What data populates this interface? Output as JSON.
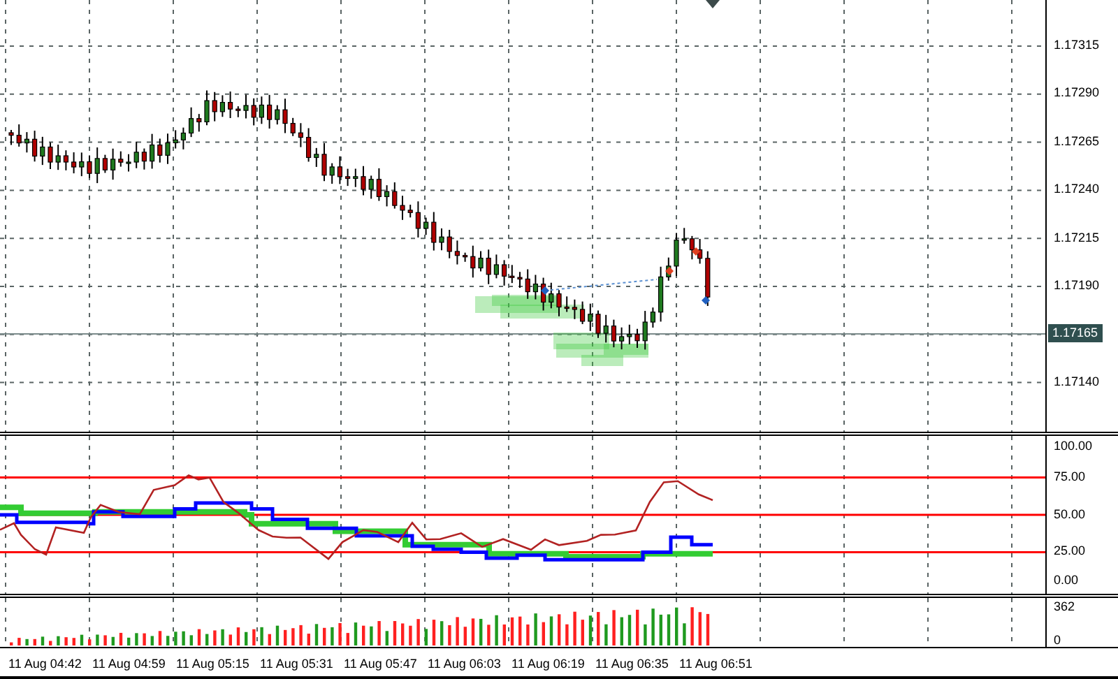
{
  "price_axis": {
    "labels": [
      "1.17315",
      "1.17290",
      "1.17265",
      "1.17240",
      "1.17215",
      "1.17190",
      "1.17140"
    ],
    "current_price": "1.17165"
  },
  "oscillator_axis": {
    "labels": [
      "100.00",
      "75.00",
      "50.00",
      "25.00",
      "0.00"
    ]
  },
  "volume_axis": {
    "labels": [
      "362",
      "0"
    ]
  },
  "time_axis": {
    "labels": [
      "11 Aug 04:42",
      "11 Aug 04:59",
      "11 Aug 05:15",
      "11 Aug 05:31",
      "11 Aug 05:47",
      "11 Aug 06:03",
      "11 Aug 06:19",
      "11 Aug 06:35",
      "11 Aug 06:51"
    ]
  }
}
